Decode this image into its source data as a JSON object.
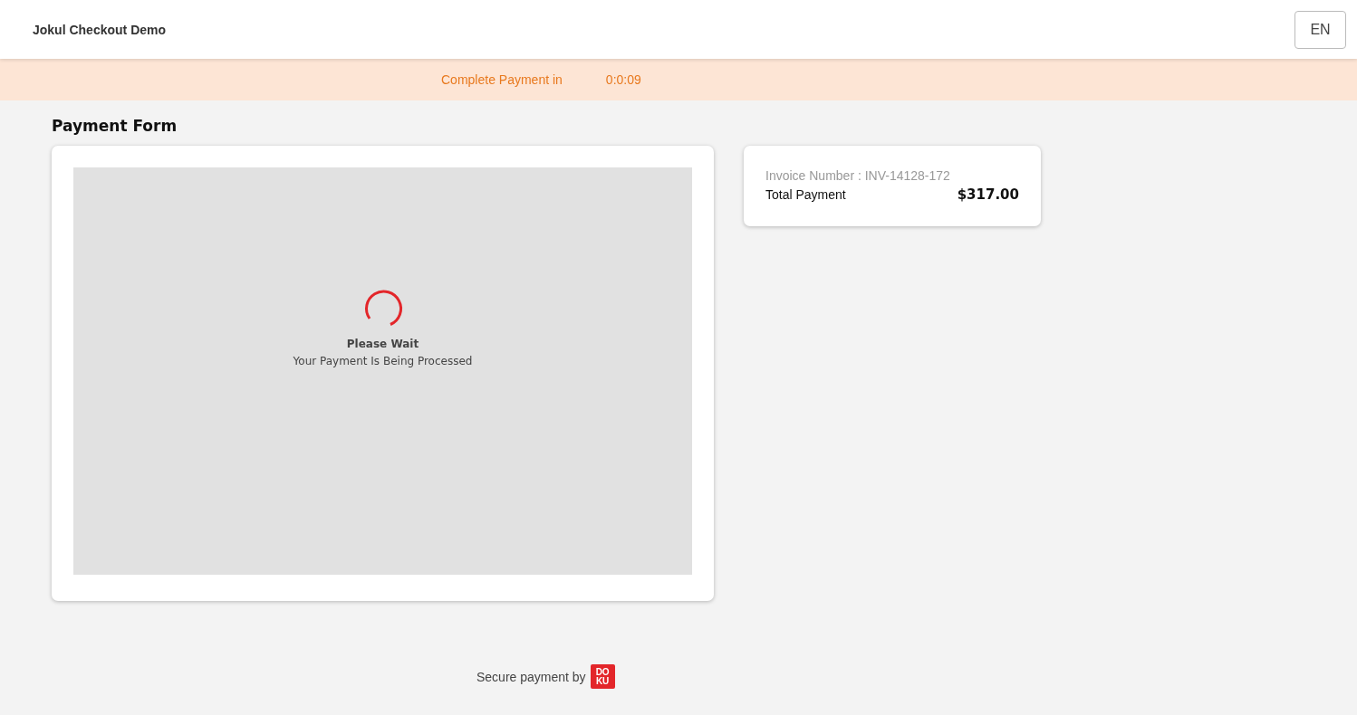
{
  "header": {
    "title": "Jokul Checkout Demo",
    "language_button": "EN"
  },
  "timer_bar": {
    "label": "Complete Payment in",
    "time": "0:0:09"
  },
  "payment_form": {
    "title": "Payment Form",
    "loading": {
      "title": "Please Wait",
      "message": "Your Payment Is Being Processed"
    }
  },
  "summary": {
    "invoice": "Invoice Number : INV-14128-172",
    "total_label": "Total Payment",
    "total_value": "$317.00"
  },
  "footer": {
    "text": "Secure payment by",
    "logo_lines": [
      "DO",
      "KU"
    ]
  }
}
